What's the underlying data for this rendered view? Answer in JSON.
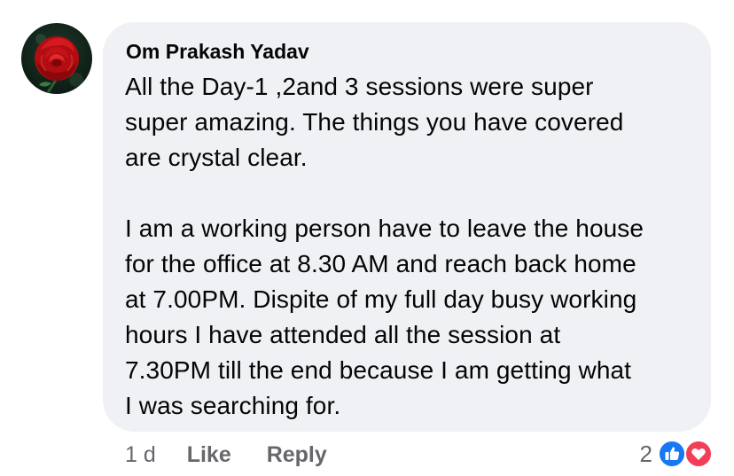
{
  "comment": {
    "author": "Om Prakash Yadav",
    "avatar_icon": "rose-avatar",
    "paragraph1": [
      "All the Day-1 ,2and 3 sessions were super",
      "super amazing. The things you have covered",
      "are crystal clear."
    ],
    "paragraph2": [
      "I am a working person have to leave the house",
      "for the office at 8.30 AM and reach back home",
      "at 7.00PM. Dispite of my full day busy working",
      "hours I have attended all the session at",
      "7.30PM  till the end because I am getting what",
      "I was searching for."
    ]
  },
  "actions": {
    "time": "1 d",
    "like_label": "Like",
    "reply_label": "Reply"
  },
  "reactions": {
    "count": "2",
    "icons": [
      "like-reaction-icon",
      "love-reaction-icon"
    ],
    "like_color": "#1877f2",
    "love_color": "#f33e58"
  },
  "colors": {
    "bubble": "#eff1f4",
    "text": "#050505",
    "secondary": "#65676b"
  }
}
